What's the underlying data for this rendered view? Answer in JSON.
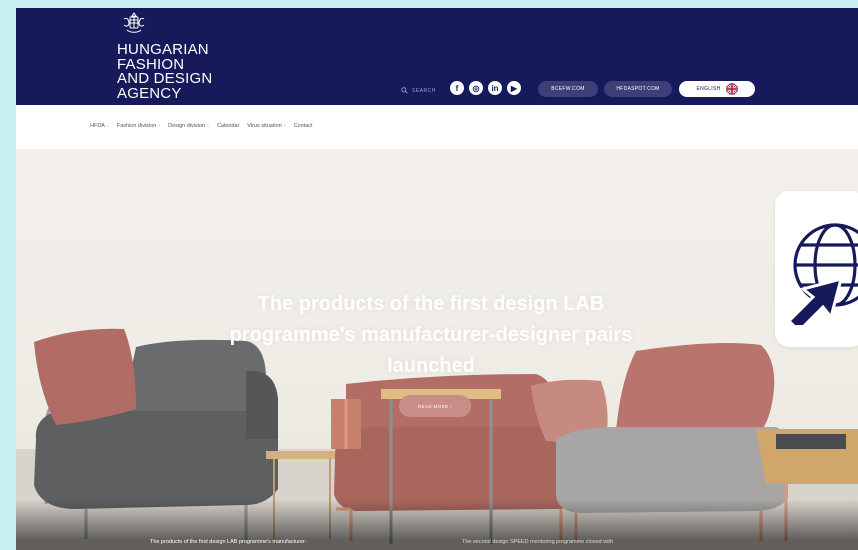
{
  "brand": {
    "logo_lines": [
      "HUNGARIAN",
      "FASHION",
      "AND DESIGN",
      "AGENCY"
    ]
  },
  "header": {
    "search_label": "SEARCH",
    "social_icons": [
      "facebook-icon",
      "instagram-icon",
      "linkedin-icon",
      "youtube-icon"
    ],
    "social_glyphs": [
      "f",
      "◎",
      "in",
      "▶"
    ],
    "bcefw_label": "BCEFW.COM",
    "hfdaspot_label": "HFDASPOT.COM",
    "language_label": "ENGLISH"
  },
  "nav": {
    "items": [
      {
        "label": "HFDA",
        "has_dropdown": true
      },
      {
        "label": "Fashion division",
        "has_dropdown": true
      },
      {
        "label": "Design division",
        "has_dropdown": true
      },
      {
        "label": "Calendar",
        "has_dropdown": false
      },
      {
        "label": "Virus situation",
        "has_dropdown": true
      },
      {
        "label": "Contact",
        "has_dropdown": false
      }
    ],
    "dropdown_glyph": "›"
  },
  "hero": {
    "title": "The products of the first design LAB programme's manufacturer-designer pairs launched",
    "read_more_label": "READ MORE  ›"
  },
  "captions": [
    "The products of the first design LAB programme's manufacturer-",
    "The second design SPEED mentoring programme closed with"
  ],
  "colors": {
    "header_bg": "#16195a",
    "accent_pill": "#c98d87",
    "page_bg": "#c9eef2"
  },
  "overlay": {
    "icon": "globe-cursor-icon"
  }
}
